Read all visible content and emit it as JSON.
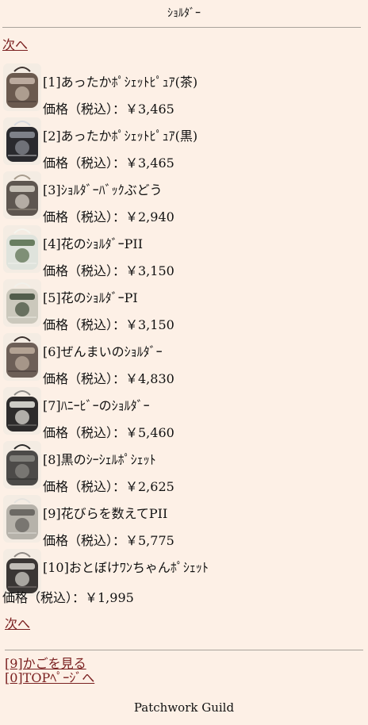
{
  "header": {
    "title": "ｼｮﾙﾀﾞｰ"
  },
  "nav": {
    "next_label": "次へ"
  },
  "items": [
    {
      "name": "[1]あったかﾎﾟｼｪｯﾄﾋﾟｭｱ(茶)",
      "price": "価格（税込）：￥3,465",
      "colors": [
        "#6b5a4f",
        "#c9b9ab",
        "#3e3430"
      ]
    },
    {
      "name": "[2]あったかﾎﾟｼｪｯﾄﾋﾟｭｱ(黒)",
      "price": "価格（税込）：￥3,465",
      "colors": [
        "#2a2a2e",
        "#8d9099",
        "#d7d9de"
      ]
    },
    {
      "name": "[3]ｼｮﾙﾀﾞｰﾊﾞｯｸぶどう",
      "price": "価格（税込）：￥2,940",
      "colors": [
        "#5e5650",
        "#d8d2c8",
        "#a79b8c"
      ]
    },
    {
      "name": "[4]花のｼｮﾙﾀﾞｰPII",
      "price": "価格（税込）：￥3,150",
      "colors": [
        "#dfe3dc",
        "#556b4a",
        "#f5f5ee"
      ]
    },
    {
      "name": "[5]花のｼｮﾙﾀﾞｰPI",
      "price": "価格（税込）：￥3,150",
      "colors": [
        "#cbc8bc",
        "#3d4a38",
        "#f2f0ea"
      ]
    },
    {
      "name": "[6]ぜんまいのｼｮﾙﾀﾞｰ",
      "price": "価格（税込）：￥4,830",
      "colors": [
        "#6d5f57",
        "#bfae9e",
        "#3a302c"
      ]
    },
    {
      "name": "[7]ﾊﾆｰﾋﾞｰのｼｮﾙﾀﾞｰ",
      "price": "価格（税込）：￥5,460",
      "colors": [
        "#2d2b2b",
        "#e9e7e0",
        "#8c8a86"
      ]
    },
    {
      "name": "[8]黒のｼｰｼｪﾙﾎﾟｼｪｯﾄ",
      "price": "価格（税込）：￥2,625",
      "colors": [
        "#4c4a48",
        "#8b8985",
        "#2c2b2a"
      ]
    },
    {
      "name": "[9]花びらを数えてPII",
      "price": "価格（税込）：￥5,775",
      "colors": [
        "#b6b2aa",
        "#5f5c58",
        "#e6e3de"
      ]
    },
    {
      "name": "[10]おとぼけﾜﾝちゃんﾎﾟｼｪｯﾄ",
      "price": "価格（税込）：￥1,995",
      "colors": [
        "#3a3634",
        "#d9d5cf",
        "#8e8883"
      ]
    }
  ],
  "footer_links": {
    "cart": "[9]かごを見る",
    "top": "[0]TOPﾍﾟｰｼﾞへ"
  },
  "footer": {
    "brand": "Patchwork Guild"
  }
}
